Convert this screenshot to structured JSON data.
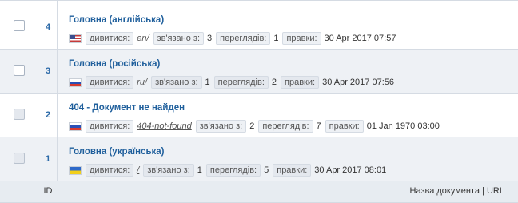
{
  "rows": [
    {
      "id": "4",
      "title": "Головна (англійська)",
      "flag": "us-flag",
      "view_label": "дивитися:",
      "url": "en/",
      "linked_label": "зв'язано з:",
      "linked": "3",
      "views_label": "переглядів:",
      "views": "1",
      "edits_label": "правки:",
      "edited": "30 Apr 2017 07:57",
      "checkbox_disabled": false
    },
    {
      "id": "3",
      "title": "Головна (російська)",
      "flag": "ru-flag",
      "view_label": "дивитися:",
      "url": "ru/",
      "linked_label": "зв'язано з:",
      "linked": "1",
      "views_label": "переглядів:",
      "views": "2",
      "edits_label": "правки:",
      "edited": "30 Apr 2017 07:56",
      "checkbox_disabled": false
    },
    {
      "id": "2",
      "title": "404 - Документ не найден",
      "flag": "ru-flag",
      "view_label": "дивитися:",
      "url": "404-not-found",
      "linked_label": "зв'язано з:",
      "linked": "2",
      "views_label": "переглядів:",
      "views": "7",
      "edits_label": "правки:",
      "edited": "01 Jan 1970 03:00",
      "checkbox_disabled": true
    },
    {
      "id": "1",
      "title": "Головна (українська)",
      "flag": "ua-flag",
      "view_label": "дивитися:",
      "url": "/",
      "linked_label": "зв'язано з:",
      "linked": "1",
      "views_label": "переглядів:",
      "views": "5",
      "edits_label": "правки:",
      "edited": "30 Apr 2017 08:01",
      "checkbox_disabled": true
    }
  ],
  "footer": {
    "id_header": "ID",
    "name_header": "Назва документа | URL"
  },
  "colors": {
    "title_link": "#1f5f9c",
    "row_alt": "#eef1f5",
    "footer_bg": "#e7ecf1",
    "border": "#d5dbe3"
  }
}
